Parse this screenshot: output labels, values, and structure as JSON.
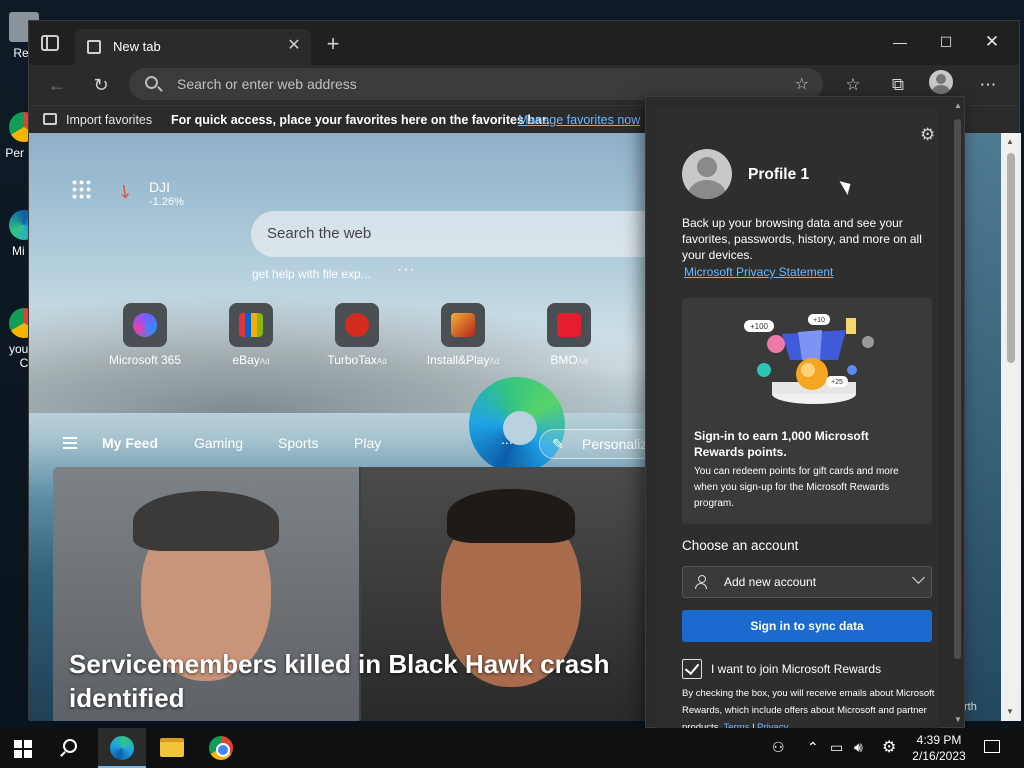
{
  "desktop": {
    "icons": [
      {
        "label": "Rec"
      },
      {
        "label": "Per Ch"
      },
      {
        "label": "Mi E"
      },
      {
        "label": "yout - C"
      }
    ]
  },
  "browser": {
    "tab_title": "New tab",
    "address_placeholder": "Search or enter web address",
    "favorites_bar": {
      "import_label": "Import favorites",
      "message": "For quick access, place your favorites here on the favorites bar.",
      "manage_link": "Manage favorites now"
    }
  },
  "newtab": {
    "stock": {
      "name": "DJI",
      "change": "-1.26%"
    },
    "search_placeholder": "Search the web",
    "suggestion": "get help with file exp...",
    "quick_links": [
      {
        "label": "Microsoft 365",
        "ad": ""
      },
      {
        "label": "eBay",
        "ad": "Ad"
      },
      {
        "label": "TurboTax",
        "ad": "Ad"
      },
      {
        "label": "Install&Play",
        "ad": "Ad"
      },
      {
        "label": "BMO",
        "ad": "Ad"
      }
    ],
    "feed_tabs": [
      "My Feed",
      "Gaming",
      "Sports",
      "Play"
    ],
    "feed_more": "...",
    "personalize": "Personalize",
    "headline": "Servicemembers killed in Black Hawk crash identified",
    "side_label": "rth"
  },
  "profile_flyout": {
    "name": "Profile 1",
    "backup_text": "Back up your browsing data and see your favorites, passwords, history, and more on all your devices.",
    "privacy_link": "Microsoft Privacy Statement",
    "rewards_art": {
      "badge_100": "+100",
      "badge_10": "+10",
      "badge_25": "+25"
    },
    "rewards_title": "Sign-in to earn 1,000 Microsoft Rewards points.",
    "rewards_desc": "You can redeem points for gift cards and more when you sign-up for the Microsoft Rewards program.",
    "choose_account_label": "Choose an account",
    "account_option": "Add new account",
    "sync_button": "Sign in to sync data",
    "rewards_checkbox_label": "I want to join Microsoft Rewards",
    "rewards_checkbox_checked": true,
    "fine_print": "By checking the box, you will receive emails about Microsoft Rewards, which include offers about Microsoft and partner products.",
    "terms_link": "Terms",
    "separator": "|",
    "privacy_link_short": "Privacy"
  },
  "taskbar": {
    "time": "4:39 PM",
    "date": "2/16/2023"
  },
  "colors": {
    "accent_blue": "#1a6ad0",
    "link_blue": "#6cb8ff",
    "stock_down": "#e0573c"
  }
}
